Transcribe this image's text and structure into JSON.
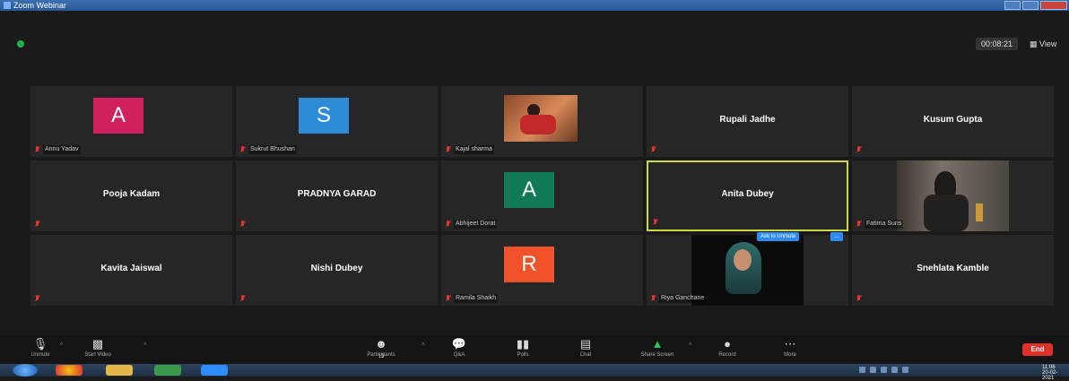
{
  "window": {
    "title": "Zoom Webinar"
  },
  "topbar": {
    "timer": "00:08:21",
    "view_label": "View"
  },
  "participants": [
    {
      "name": "Annu Yadav",
      "avatar_letter": "A",
      "avatar_color": "#d0205f"
    },
    {
      "name": "Sukrut Bhushan",
      "avatar_letter": "S",
      "avatar_color": "#2d8bd8"
    },
    {
      "name": "Kajal sharma"
    },
    {
      "name": "Rupali Jadhe"
    },
    {
      "name": "Kusum Gupta"
    },
    {
      "name": "Pooja Kadam"
    },
    {
      "name": "PRADNYA GARAD"
    },
    {
      "name": "Abhijeet Dorat",
      "avatar_letter": "A",
      "avatar_color": "#0f7a55"
    },
    {
      "name": "Anita Dubey"
    },
    {
      "name": "Fatima Suns"
    },
    {
      "name": "Kavita Jaiswal"
    },
    {
      "name": "Nishi Dubey"
    },
    {
      "name": "Ramila Shaikh",
      "avatar_letter": "R",
      "avatar_color": "#f0532a"
    },
    {
      "name": "Riya Ganchane"
    },
    {
      "name": "Snehlata Kamble"
    }
  ],
  "ask_badge": {
    "label": "Ask to Unmute",
    "more": "..."
  },
  "toolbar": {
    "unmute": "Unmute",
    "start_video": "Start Video",
    "participants": "Participants",
    "participants_count": "13",
    "qa": "Q&A",
    "polls": "Polls",
    "chat": "Chat",
    "share_screen": "Share Screen",
    "record": "Record",
    "more": "More",
    "end": "End"
  },
  "taskbar": {
    "time": "11:06",
    "date": "20-02-2021"
  }
}
